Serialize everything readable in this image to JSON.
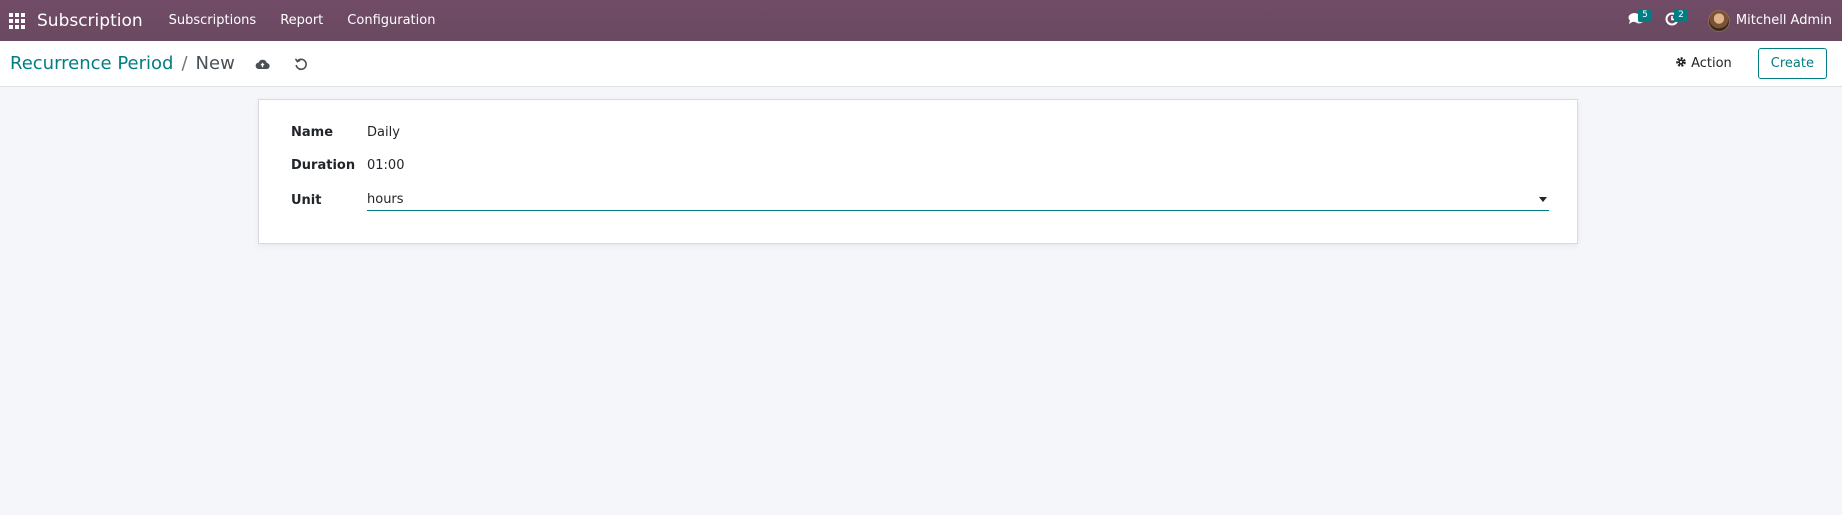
{
  "navbar": {
    "app_name": "Subscription",
    "menu": [
      "Subscriptions",
      "Report",
      "Configuration"
    ],
    "messages_badge": "5",
    "activities_badge": "2",
    "user_name": "Mitchell Admin"
  },
  "control_panel": {
    "breadcrumb_parent": "Recurrence Period",
    "breadcrumb_separator": "/",
    "breadcrumb_current": "New",
    "action_label": "Action",
    "create_label": "Create"
  },
  "form": {
    "name_label": "Name",
    "name_value": "Daily",
    "duration_label": "Duration",
    "duration_value": "01:00",
    "unit_label": "Unit",
    "unit_value": "hours"
  },
  "colors": {
    "navbar": "#714b67",
    "accent": "#017e84",
    "background": "#f5f6fa"
  }
}
